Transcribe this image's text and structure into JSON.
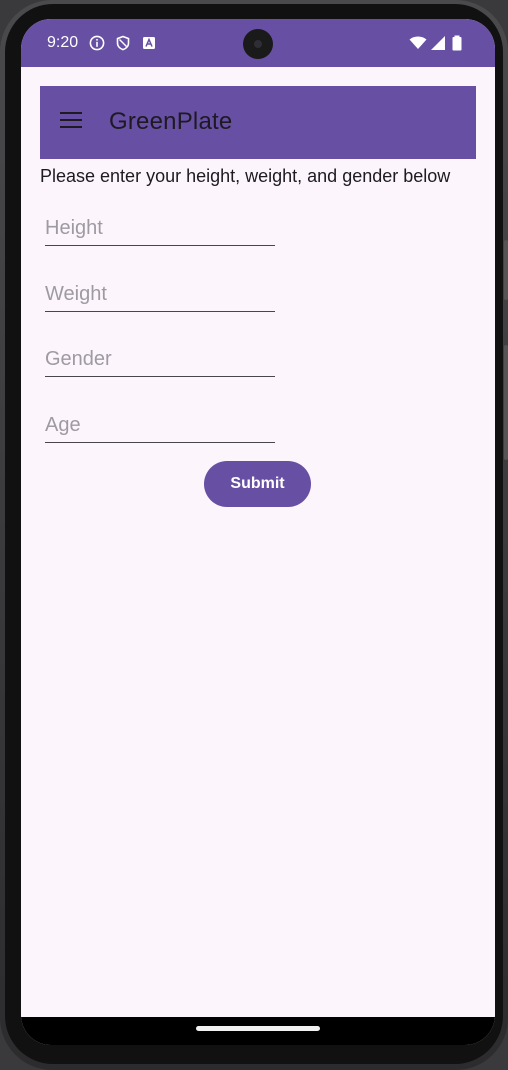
{
  "status_bar": {
    "time": "9:20",
    "icons": [
      "info-icon",
      "shield-icon",
      "a-notification-icon",
      "wifi-icon",
      "signal-icon",
      "battery-icon"
    ],
    "color": "#674fa3"
  },
  "app_bar": {
    "title": "GreenPlate",
    "menu_icon": "hamburger-menu-icon",
    "color": "#674fa3"
  },
  "form": {
    "instruction": "Please enter your height, weight, and gender below",
    "fields": [
      {
        "placeholder": "Height",
        "value": ""
      },
      {
        "placeholder": "Weight",
        "value": ""
      },
      {
        "placeholder": "Gender",
        "value": ""
      },
      {
        "placeholder": "Age",
        "value": ""
      }
    ],
    "submit_label": "Submit"
  },
  "theme": {
    "primary": "#674fa3",
    "background": "#fcf5fc",
    "on_surface": "#1d1a22"
  }
}
